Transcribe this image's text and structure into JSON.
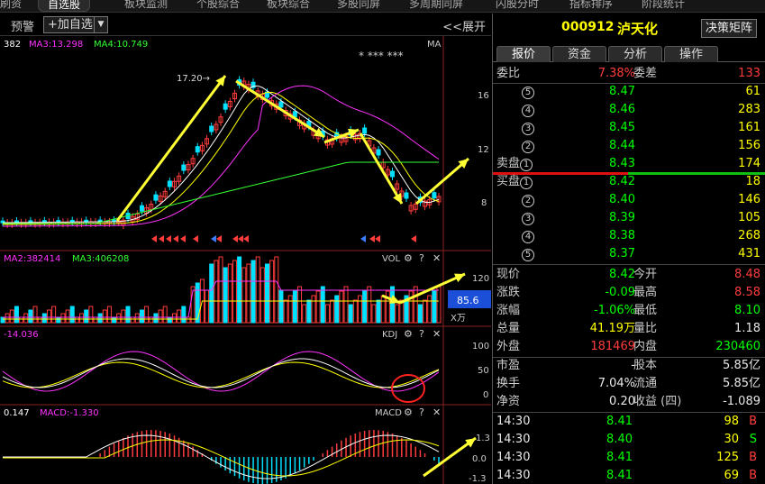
{
  "topnav": {
    "tabs": [
      "刷资",
      "自选股",
      "板块监测",
      "个股综合",
      "板块综合",
      "多股同屏",
      "多周期同屏",
      "闪股分时",
      "指标排序",
      "阶段统计"
    ],
    "active_index": 1
  },
  "toolbar": {
    "warn_label": "预警",
    "add_label": "+加自选",
    "dropdown_label": "▼",
    "expand_label": "<<展开"
  },
  "chart": {
    "ma_legend": [
      {
        "label": "382",
        "color": "#ffffff"
      },
      {
        "label": "MA3:13.298",
        "color": "#ff33ff"
      },
      {
        "label": "MA4:10.749",
        "color": "#33ff33"
      }
    ],
    "ma_tag": "MA",
    "stars": "* ***   ***",
    "peak_label": "17.20→",
    "price_axis": [
      "16",
      "12",
      "8"
    ],
    "vol_legend": [
      {
        "label": "MA2:382414",
        "color": "#ff33ff"
      },
      {
        "label": "MA3:406208",
        "color": "#33ff33"
      }
    ],
    "vol_title": "VOL",
    "vol_axis_top": "120",
    "vol_current": "85.6",
    "vol_unit": "X万",
    "kdj_legend": {
      "label": "-14.036",
      "color": "#ff33ff"
    },
    "kdj_title": "KDJ",
    "kdj_axis": [
      "100",
      "50",
      "0"
    ],
    "macd_legend": [
      {
        "label": "0.147",
        "color": "#ffffff"
      },
      {
        "label": "MACD:-1.330",
        "color": "#ff33ff"
      }
    ],
    "macd_title": "MACD",
    "macd_axis": [
      "1.3",
      "0.0",
      "-1.3"
    ]
  },
  "stock": {
    "code": "000912",
    "name": "泸天化",
    "matrix_label": "决策矩阵"
  },
  "right_tabs": [
    "报价",
    "资金",
    "分析",
    "操作"
  ],
  "order_book": {
    "ratio_label": "委比",
    "ratio_value": "7.38%",
    "diff_label": "委差",
    "diff_value": "133",
    "sell": [
      {
        "level": "5",
        "price": "8.47",
        "vol": "61"
      },
      {
        "level": "4",
        "price": "8.46",
        "vol": "283"
      },
      {
        "level": "3",
        "price": "8.45",
        "vol": "161"
      },
      {
        "level": "2",
        "price": "8.44",
        "vol": "156"
      },
      {
        "level": "1",
        "label": "卖盘",
        "price": "8.43",
        "vol": "174"
      }
    ],
    "buy": [
      {
        "level": "1",
        "label": "买盘",
        "price": "8.42",
        "vol": "18"
      },
      {
        "level": "2",
        "price": "8.40",
        "vol": "146"
      },
      {
        "level": "3",
        "price": "8.39",
        "vol": "105"
      },
      {
        "level": "4",
        "price": "8.38",
        "vol": "268"
      },
      {
        "level": "5",
        "price": "8.37",
        "vol": "431"
      }
    ]
  },
  "quote": {
    "now_label": "现价",
    "now": "8.42",
    "open_label": "今开",
    "open": "8.48",
    "chg_label": "涨跌",
    "chg": "-0.09",
    "high_label": "最高",
    "high": "8.58",
    "pct_label": "涨幅",
    "pct": "-1.06%",
    "low_label": "最低",
    "low": "8.10",
    "total_label": "总量",
    "total": "41.19万",
    "ratio_label": "量比",
    "ratio": "1.18",
    "out_label": "外盘",
    "out": "181469",
    "in_label": "内盘",
    "in": "230460"
  },
  "fundamentals": {
    "pe_label": "市盈",
    "pe": "-",
    "share_label": "股本",
    "share": "5.85亿",
    "turn_label": "换手",
    "turn": "7.04%",
    "float_label": "流通",
    "float": "5.85亿",
    "nav_label": "净资",
    "nav": "0.20",
    "eps_label": "收益 (四)",
    "eps": "-1.089"
  },
  "trades": [
    {
      "time": "14:30",
      "price": "8.41",
      "vol": "98",
      "side": "B"
    },
    {
      "time": "14:30",
      "price": "8.40",
      "vol": "30",
      "side": "S"
    },
    {
      "time": "14:30",
      "price": "8.41",
      "vol": "125",
      "side": "B"
    },
    {
      "time": "14:30",
      "price": "8.41",
      "vol": "69",
      "side": "B"
    }
  ]
}
